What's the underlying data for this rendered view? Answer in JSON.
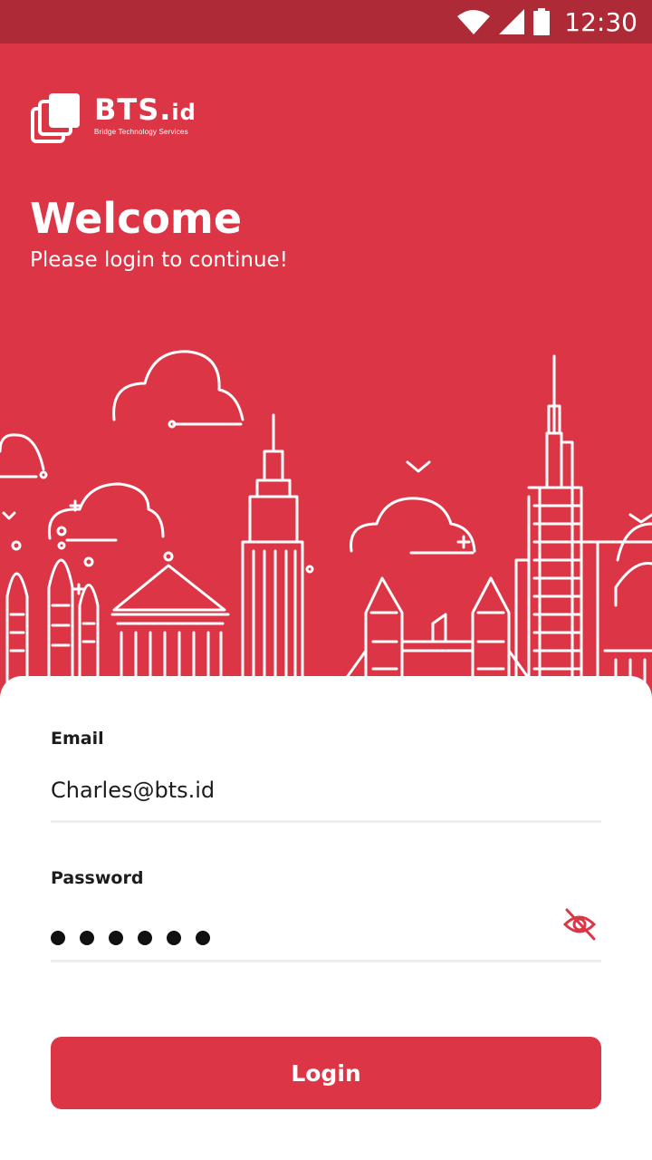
{
  "status_bar": {
    "time": "12:30"
  },
  "brand": {
    "name": "BTS.",
    "suffix": "id",
    "tagline": "Bridge Technology Services",
    "accent_color": "#dc3545"
  },
  "hero": {
    "title": "Welcome",
    "subtitle": "Please login to continue!"
  },
  "form": {
    "email_label": "Email",
    "email_value": "Charles@bts.id",
    "password_label": "Password",
    "password_masked_length": 6,
    "login_label": "Login"
  },
  "icons": {
    "status": [
      "wifi-icon",
      "signal-icon",
      "battery-icon"
    ],
    "password_toggle": "eye-off-icon"
  }
}
